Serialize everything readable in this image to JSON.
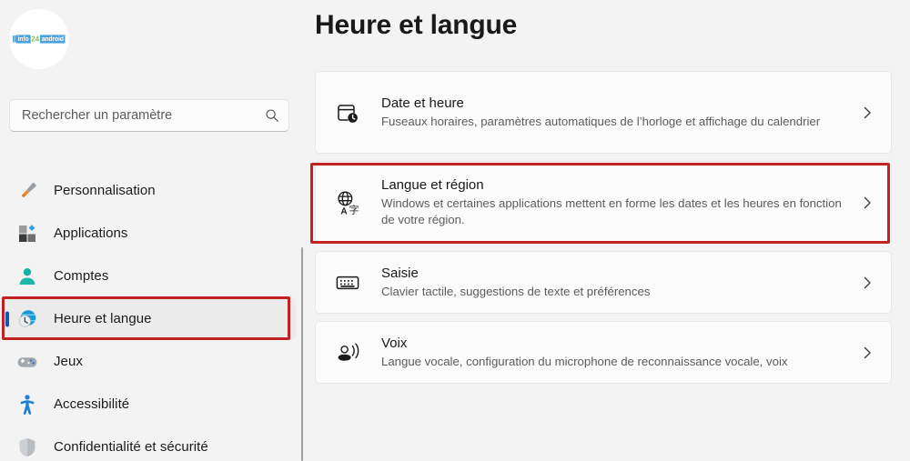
{
  "window": {
    "background_color": "#f3f3f3",
    "card_color": "#fbfbfb",
    "accent_color": "#0f5ab6",
    "highlight_color": "#c22222"
  },
  "sidebar": {
    "avatar": {
      "name": "user-avatar",
      "logo_bars": "|||",
      "logo_info": "info",
      "logo_24": "24",
      "logo_android": "android"
    },
    "search": {
      "placeholder": "Rechercher un paramètre",
      "value": "",
      "icon": "search-icon"
    },
    "items": [
      {
        "label": "Personnalisation",
        "icon": "paintbrush-icon",
        "selected": false
      },
      {
        "label": "Applications",
        "icon": "apps-grid-icon",
        "selected": false
      },
      {
        "label": "Comptes",
        "icon": "person-account-icon",
        "selected": false
      },
      {
        "label": "Heure et langue",
        "icon": "clock-globe-icon",
        "selected": true
      },
      {
        "label": "Jeux",
        "icon": "gamepad-icon",
        "selected": false
      },
      {
        "label": "Accessibilité",
        "icon": "accessibility-person-icon",
        "selected": false
      },
      {
        "label": "Confidentialité et sécurité",
        "icon": "shield-icon",
        "selected": false
      }
    ]
  },
  "main": {
    "title": "Heure et langue",
    "cards": [
      {
        "title": "Date et heure",
        "subtitle": "Fuseaux horaires, paramètres automatiques de l’horloge et affichage du calendrier",
        "icon": "calendar-clock-icon",
        "chevron": "chevron-right-icon",
        "highlighted": false
      },
      {
        "title": "Langue et région",
        "subtitle": "Windows et certaines applications mettent en forme les dates et les heures en fonction de votre région.",
        "icon": "translate-globe-icon",
        "chevron": "chevron-right-icon",
        "highlighted": true
      },
      {
        "title": "Saisie",
        "subtitle": "Clavier tactile, suggestions de texte et préférences",
        "icon": "keyboard-icon",
        "chevron": "chevron-right-icon",
        "highlighted": false
      },
      {
        "title": "Voix",
        "subtitle": "Langue vocale, configuration du microphone de reconnaissance vocale, voix",
        "icon": "voice-speech-icon",
        "chevron": "chevron-right-icon",
        "highlighted": false
      }
    ]
  }
}
